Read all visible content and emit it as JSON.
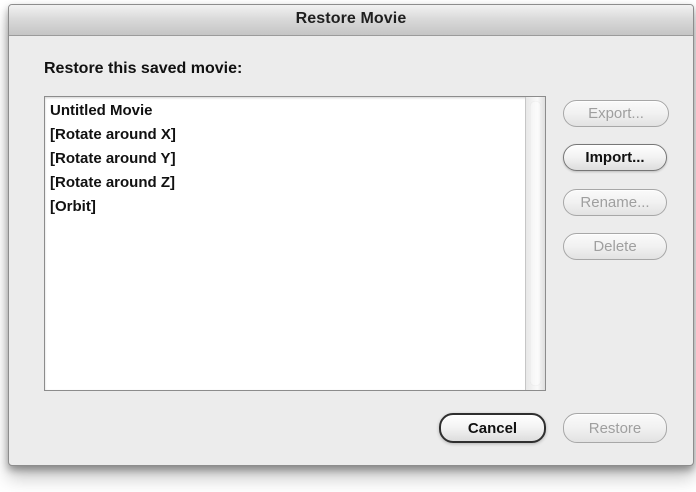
{
  "window": {
    "title": "Restore Movie"
  },
  "content": {
    "heading": "Restore this saved movie:",
    "movies": [
      "Untitled Movie",
      "[Rotate around X]",
      "[Rotate around Y]",
      "[Rotate around Z]",
      "[Orbit]"
    ]
  },
  "actions": {
    "export": "Export...",
    "import": "Import...",
    "rename": "Rename...",
    "delete": "Delete",
    "cancel": "Cancel",
    "restore": "Restore"
  },
  "colors": {
    "dialog_bg": "#ececec",
    "button_border": "#777777",
    "disabled_text": "#9f9f9f"
  }
}
